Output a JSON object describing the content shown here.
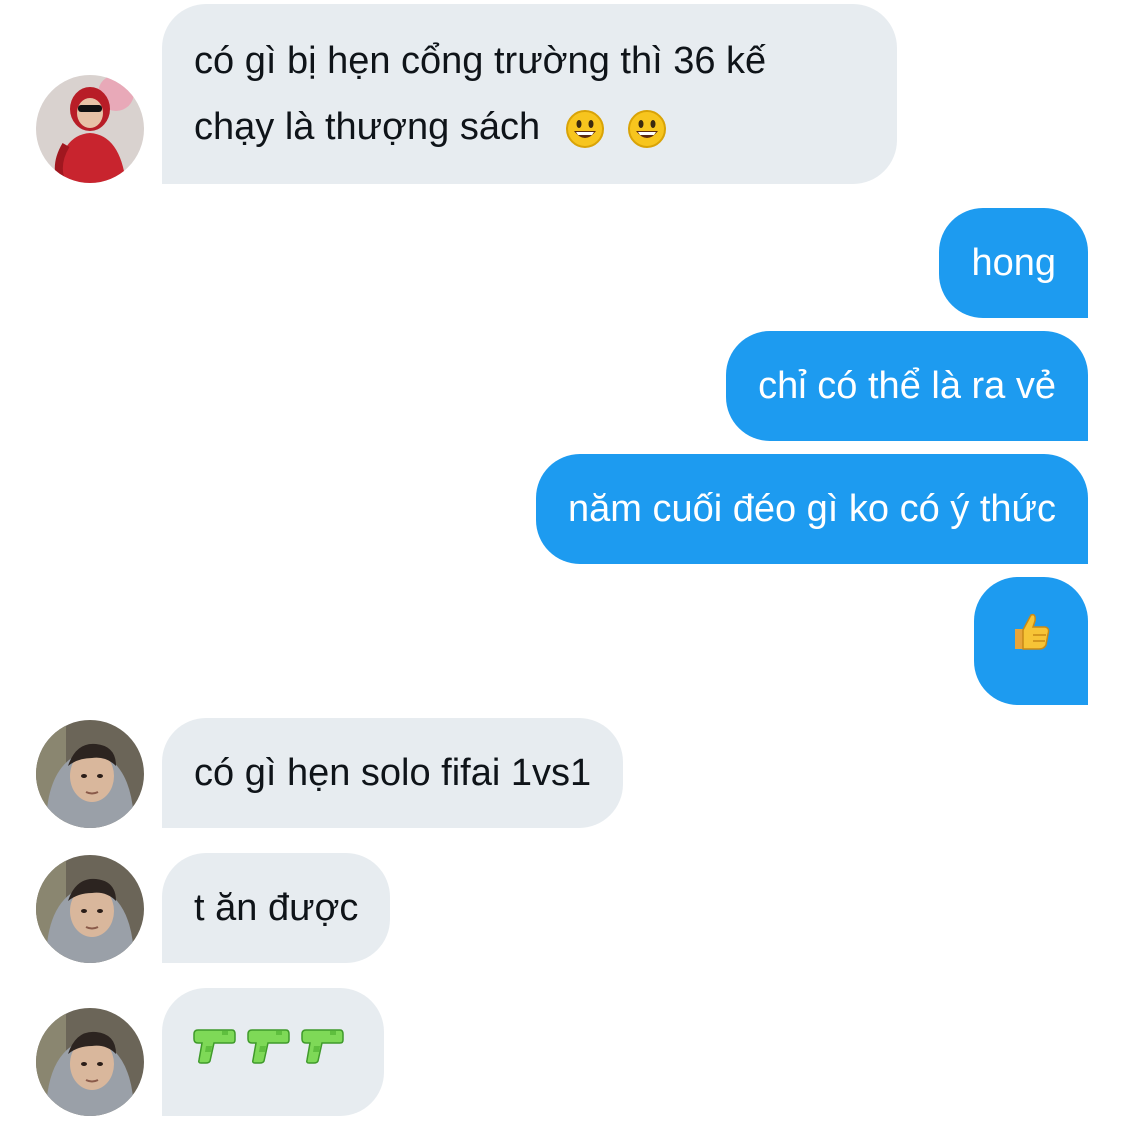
{
  "conversation": {
    "messages": [
      {
        "direction": "incoming",
        "text": "có gì bị hẹn cổng trường thì 36 kế",
        "text2": "chạy là thượng sách",
        "emoji": [
          "grinning-face",
          "grinning-face"
        ]
      },
      {
        "direction": "outgoing",
        "text": "hong"
      },
      {
        "direction": "outgoing",
        "text": "chỉ có thể là ra vẻ"
      },
      {
        "direction": "outgoing",
        "text": "năm cuối đéo gì ko có ý thức"
      },
      {
        "direction": "outgoing",
        "emoji": [
          "thumbs-up"
        ]
      },
      {
        "direction": "incoming",
        "text": "có gì hẹn solo fifai 1vs1"
      },
      {
        "direction": "incoming",
        "text": "t ăn được"
      },
      {
        "direction": "incoming",
        "emoji": [
          "water-pistol",
          "water-pistol",
          "water-pistol"
        ]
      }
    ]
  },
  "colors": {
    "incoming_bubble": "#e7ecf0",
    "outgoing_bubble": "#1d9bf0",
    "incoming_text": "#0f1419",
    "outgoing_text": "#ffffff"
  }
}
